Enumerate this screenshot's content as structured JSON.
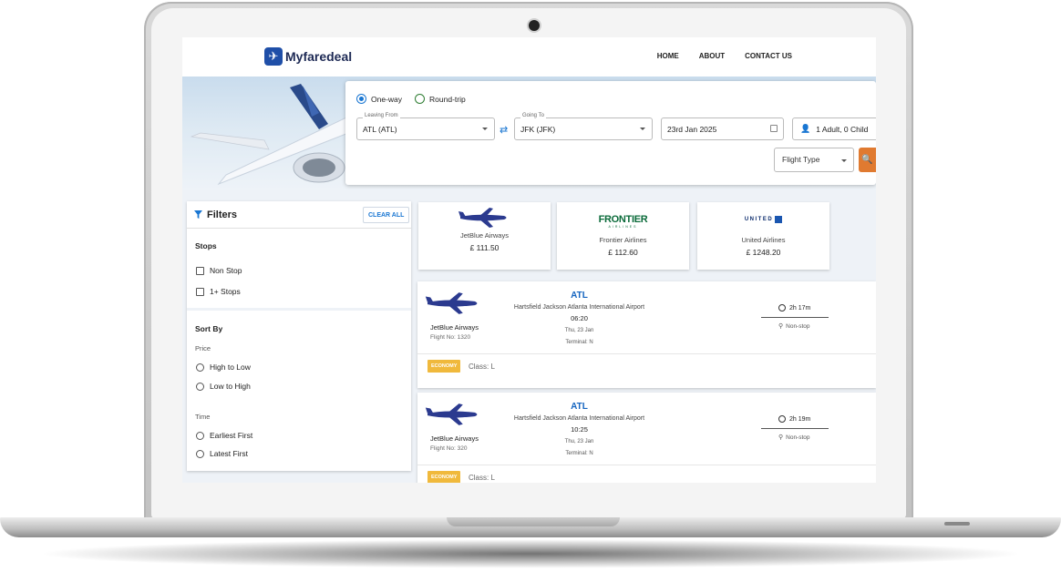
{
  "app": {
    "logo_text": "Myfaredeal"
  },
  "nav": {
    "items": [
      "HOME",
      "ABOUT",
      "CONTACT US"
    ]
  },
  "search": {
    "trip_types": [
      {
        "label": "One-way",
        "selected": true
      },
      {
        "label": "Round-trip",
        "selected": false
      }
    ],
    "from": {
      "label": "Leaving From",
      "value": "ATL (ATL)"
    },
    "to": {
      "label": "Going To",
      "value": "JFK (JFK)"
    },
    "date": {
      "value": "23rd Jan 2025"
    },
    "travellers": {
      "value": "1 Adult, 0 Child"
    },
    "flight_type": {
      "placeholder": "Flight Type"
    }
  },
  "filters": {
    "title": "Filters",
    "clear_label": "CLEAR ALL",
    "stops": {
      "title": "Stops",
      "options": [
        "Non Stop",
        "1+ Stops"
      ]
    },
    "sort": {
      "title": "Sort By",
      "price_label": "Price",
      "price_options": [
        "High to Low",
        "Low to High"
      ],
      "time_label": "Time",
      "time_options": [
        "Earliest First",
        "Latest First"
      ]
    }
  },
  "airlines": [
    {
      "name": "JetBlue Airways",
      "price": "£ 111.50",
      "logo": "plane-logo-icon"
    },
    {
      "name": "Frontier Airlines",
      "price": "£ 112.60",
      "logo_text": "FRONTIER",
      "logo_sub": "AIRLINES"
    },
    {
      "name": "United Airlines",
      "price": "£ 1248.20",
      "logo_text": "UNITED"
    }
  ],
  "flights": [
    {
      "airline": "JetBlue Airways",
      "flight_no": "Flight No: 1320",
      "code": "ATL",
      "airport": "Hartsfield Jackson Atlanta International Airport",
      "time": "06:20",
      "date": "Thu, 23 Jan",
      "terminal": "Terminal: N",
      "duration": "2h 17m",
      "stops": "Non-stop",
      "badge": "ECONOMY",
      "class": "Class: L"
    },
    {
      "airline": "JetBlue Airways",
      "flight_no": "Flight No: 320",
      "code": "ATL",
      "airport": "Hartsfield Jackson Atlanta International Airport",
      "time": "10:25",
      "date": "Thu, 23 Jan",
      "terminal": "Terminal: N",
      "duration": "2h 19m",
      "stops": "Non-stop",
      "badge": "ECONOMY",
      "class": "Class: L"
    }
  ],
  "colors": {
    "primary": "#1976d2",
    "brand": "#1e2a55",
    "search_button": "#e07a30",
    "badge": "#f0b93c"
  }
}
